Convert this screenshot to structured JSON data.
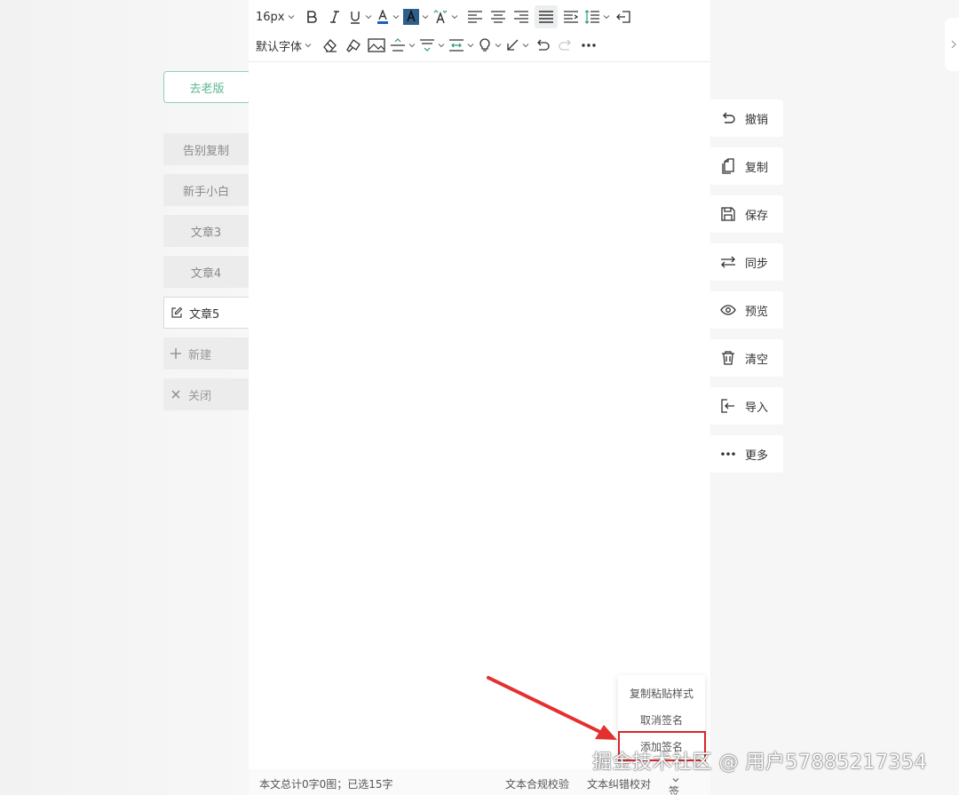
{
  "left_nav": {
    "old_version_label": "去老版",
    "tabs": [
      {
        "label": "告别复制"
      },
      {
        "label": "新手小白"
      },
      {
        "label": "文章3"
      },
      {
        "label": "文章4"
      },
      {
        "label": "文章5",
        "active": true
      }
    ],
    "new_label": "新建",
    "close_label": "关闭"
  },
  "toolbar": {
    "font_size": "16px",
    "font_family": "默认字体",
    "icons_row1": [
      "bold-icon",
      "italic-icon",
      "underline-icon",
      "font-color-icon",
      "highlight-color-icon",
      "text-style-icon",
      "align-left-icon",
      "align-center-icon",
      "align-right-icon",
      "align-justify-icon",
      "indent-icon",
      "line-height-icon",
      "exit-icon"
    ],
    "icons_row2": [
      "eraser-icon",
      "format-painter-icon",
      "image-icon",
      "divider-icon",
      "paragraph-spacing-icon",
      "letter-spacing-icon",
      "bulb-icon",
      "arrow-icon",
      "undo-icon",
      "redo-icon",
      "more-icon"
    ]
  },
  "actions": [
    {
      "label": "撤销",
      "icon": "undo-icon"
    },
    {
      "label": "复制",
      "icon": "copy-icon"
    },
    {
      "label": "保存",
      "icon": "save-icon"
    },
    {
      "label": "同步",
      "icon": "sync-icon"
    },
    {
      "label": "预览",
      "icon": "eye-icon"
    },
    {
      "label": "清空",
      "icon": "trash-icon"
    },
    {
      "label": "导入",
      "icon": "import-icon"
    },
    {
      "label": "更多",
      "icon": "more-icon"
    }
  ],
  "status_bar": {
    "count_text": "本文总计0字0图；已选15字",
    "compliance_check": "文本合规校验",
    "proofread": "文本纠错校对",
    "signature": "签名"
  },
  "signature_menu": {
    "items": [
      "复制粘贴样式",
      "取消签名",
      "添加签名"
    ]
  },
  "watermark": "掘金技术社区 @ 用户57885217354",
  "colors": {
    "accent_green": "#5bb792",
    "annotation_red": "#d9262b",
    "font_color_bar": "#1f5fbf",
    "highlight_bg": "#2e5f8a"
  }
}
